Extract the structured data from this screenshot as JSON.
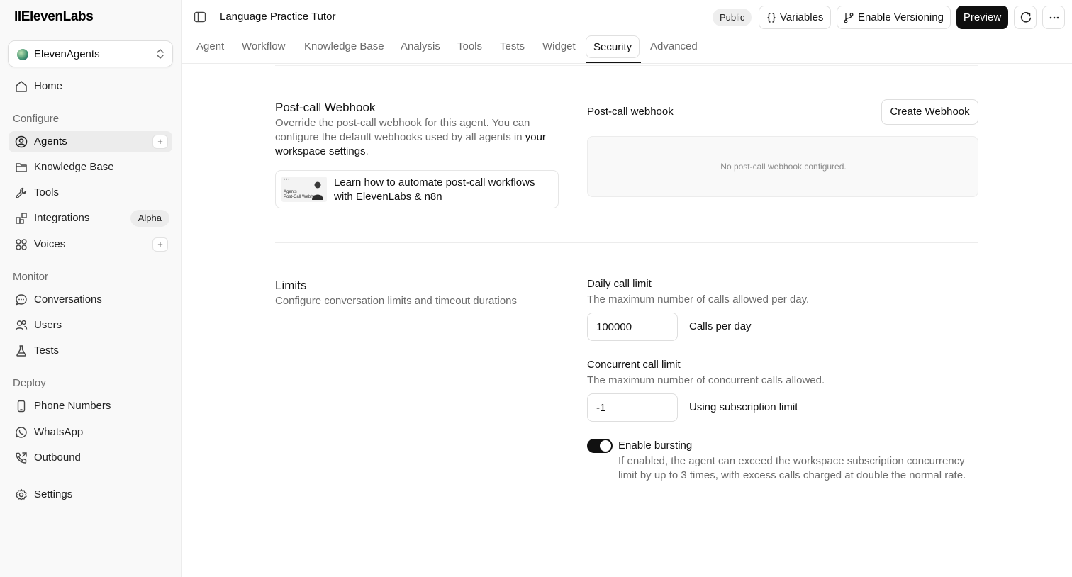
{
  "brand": {
    "logo": "IIElevenLabs"
  },
  "workspace": {
    "name": "ElevenAgents"
  },
  "sidebar": {
    "home": "Home",
    "configure_label": "Configure",
    "agents": "Agents",
    "knowledge_base": "Knowledge Base",
    "tools": "Tools",
    "integrations": "Integrations",
    "integrations_badge": "Alpha",
    "voices": "Voices",
    "monitor_label": "Monitor",
    "conversations": "Conversations",
    "users": "Users",
    "tests": "Tests",
    "deploy_label": "Deploy",
    "phone_numbers": "Phone Numbers",
    "whatsapp": "WhatsApp",
    "outbound": "Outbound",
    "settings": "Settings",
    "plus": "+"
  },
  "header": {
    "title": "Language Practice Tutor",
    "visibility": "Public",
    "variables": "Variables",
    "enable_versioning": "Enable Versioning",
    "preview": "Preview"
  },
  "tabs": [
    "Agent",
    "Workflow",
    "Knowledge Base",
    "Analysis",
    "Tools",
    "Tests",
    "Widget",
    "Security",
    "Advanced"
  ],
  "active_tab": "Security",
  "webhook": {
    "title": "Post-call Webhook",
    "desc_prefix": "Override the post-call webhook for this agent. You can configure the default webhooks used by all agents in ",
    "desc_link": "your workspace settings",
    "desc_suffix": ".",
    "learn_text": "Learn how to automate post-call workflows with ElevenLabs & n8n",
    "thumb_line1": "Agents",
    "thumb_line2": "Post-Call Webhooks",
    "field_label": "Post-call webhook",
    "create_button": "Create Webhook",
    "empty_text": "No post-call webhook configured."
  },
  "limits": {
    "title": "Limits",
    "desc": "Configure conversation limits and timeout durations",
    "daily_label": "Daily call limit",
    "daily_help": "The maximum number of calls allowed per day.",
    "daily_value": "100000",
    "daily_suffix": "Calls per day",
    "concurrent_label": "Concurrent call limit",
    "concurrent_help": "The maximum number of concurrent calls allowed.",
    "concurrent_value": "-1",
    "concurrent_suffix": "Using subscription limit",
    "bursting_label": "Enable bursting",
    "bursting_enabled": true,
    "bursting_help": "If enabled, the agent can exceed the workspace subscription concurrency limit by up to 3 times, with excess calls charged at double the normal rate."
  }
}
